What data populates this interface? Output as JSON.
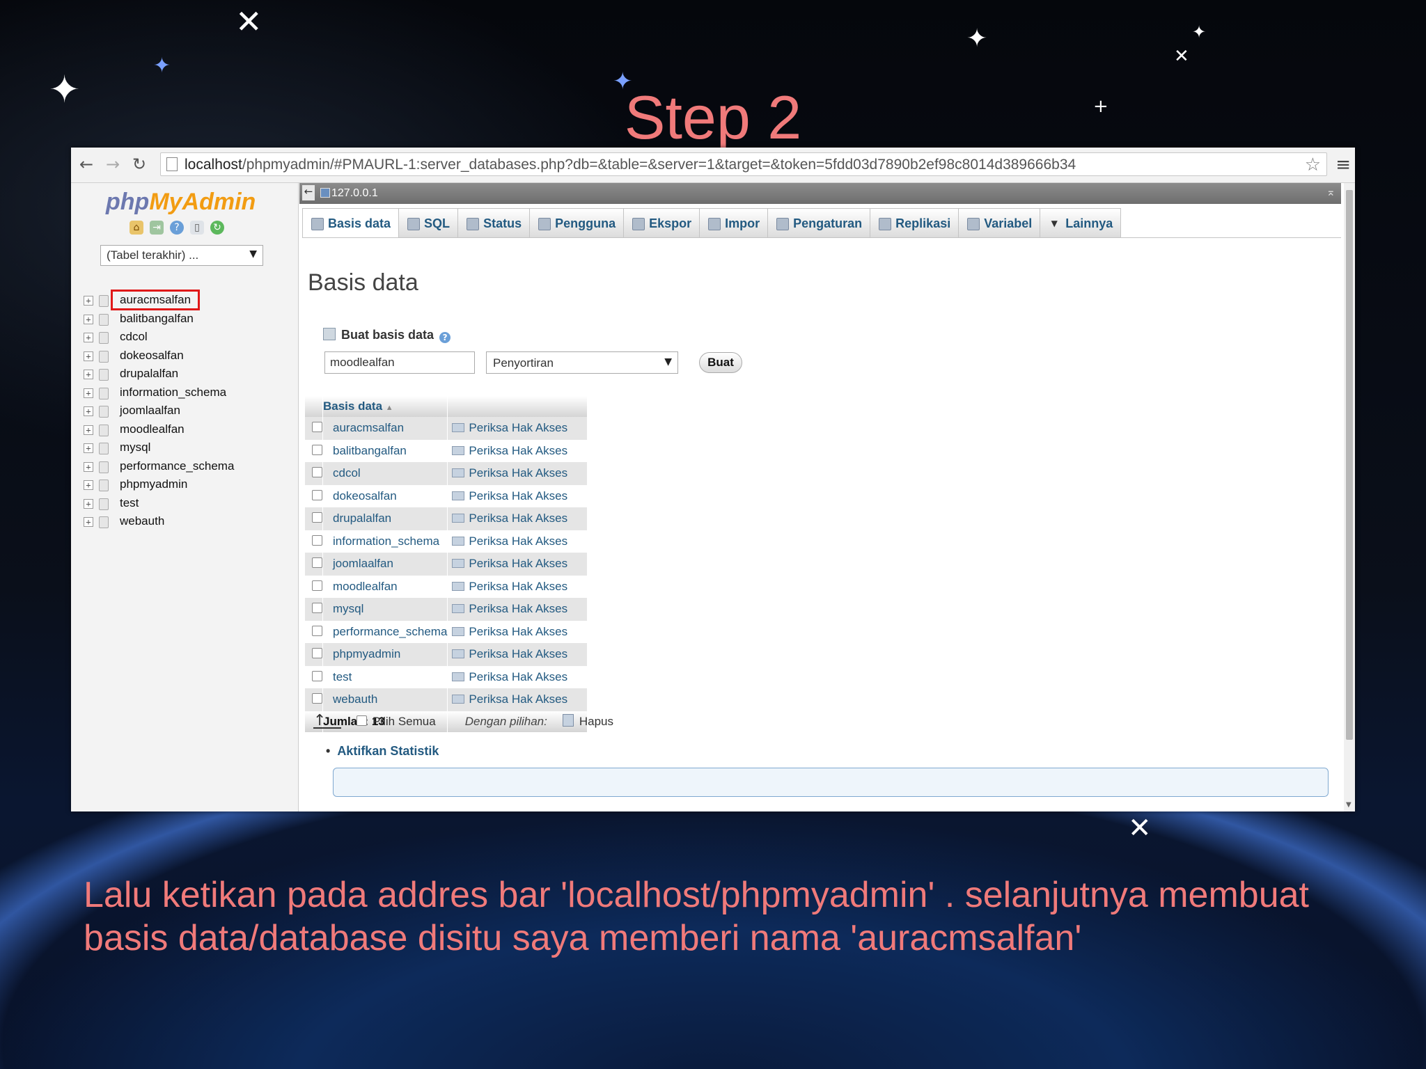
{
  "slide": {
    "title": "Step 2",
    "caption": "Lalu ketikan pada addres bar 'localhost/phpmyadmin' . selanjutnya membuat basis data/database disitu saya memberi nama 'auracmsalfan'"
  },
  "browser": {
    "url_host": "localhost",
    "url_path": "/phpmyadmin/#PMAURL-1:server_databases.php?db=&table=&server=1&target=&token=5fdd03d7890b2ef98c8014d389666b34"
  },
  "left_panel": {
    "logo": {
      "php": "php",
      "my": "My",
      "admin": "Admin"
    },
    "recent_tables": "(Tabel terakhir) ...",
    "databases": [
      "auracmsalfan",
      "balitbangalfan",
      "cdcol",
      "dokeosalfan",
      "drupalalfan",
      "information_schema",
      "joomlaalfan",
      "moodlealfan",
      "mysql",
      "performance_schema",
      "phpmyadmin",
      "test",
      "webauth"
    ],
    "highlighted": "auracmsalfan"
  },
  "server": "127.0.0.1",
  "tabs": [
    {
      "label": "Basis data",
      "icon": "database-icon"
    },
    {
      "label": "SQL",
      "icon": "sql-icon"
    },
    {
      "label": "Status",
      "icon": "status-icon"
    },
    {
      "label": "Pengguna",
      "icon": "users-icon"
    },
    {
      "label": "Ekspor",
      "icon": "export-icon"
    },
    {
      "label": "Impor",
      "icon": "import-icon"
    },
    {
      "label": "Pengaturan",
      "icon": "wrench-icon"
    },
    {
      "label": "Replikasi",
      "icon": "replication-icon"
    },
    {
      "label": "Variabel",
      "icon": "variables-icon"
    },
    {
      "label": "Lainnya",
      "icon": "triangle-down-icon"
    }
  ],
  "main": {
    "heading": "Basis data",
    "create": {
      "title": "Buat basis data",
      "input_value": "moodlealfan",
      "collation": "Penyortiran",
      "button": "Buat"
    },
    "table": {
      "column": "Basis data",
      "sort_mark": "▲",
      "rows": [
        {
          "name": "auracmsalfan",
          "action": "Periksa Hak Akses"
        },
        {
          "name": "balitbangalfan",
          "action": "Periksa Hak Akses"
        },
        {
          "name": "cdcol",
          "action": "Periksa Hak Akses"
        },
        {
          "name": "dokeosalfan",
          "action": "Periksa Hak Akses"
        },
        {
          "name": "drupalalfan",
          "action": "Periksa Hak Akses"
        },
        {
          "name": "information_schema",
          "action": "Periksa Hak Akses"
        },
        {
          "name": "joomlaalfan",
          "action": "Periksa Hak Akses"
        },
        {
          "name": "moodlealfan",
          "action": "Periksa Hak Akses"
        },
        {
          "name": "mysql",
          "action": "Periksa Hak Akses"
        },
        {
          "name": "performance_schema",
          "action": "Periksa Hak Akses"
        },
        {
          "name": "phpmyadmin",
          "action": "Periksa Hak Akses"
        },
        {
          "name": "test",
          "action": "Periksa Hak Akses"
        },
        {
          "name": "webauth",
          "action": "Periksa Hak Akses"
        }
      ],
      "total": "Jumlah: 13"
    },
    "footer": {
      "select_all": "Pilih Semua",
      "with_selected": "Dengan pilihan:",
      "delete": "Hapus"
    },
    "stats_link": "Aktifkan Statistik"
  },
  "colors": {
    "slide_text": "#f07a7a",
    "link": "#235a81",
    "highlight_box": "#e01818",
    "logo_php": "#6c78af",
    "logo_myadmin": "#f29c12"
  }
}
